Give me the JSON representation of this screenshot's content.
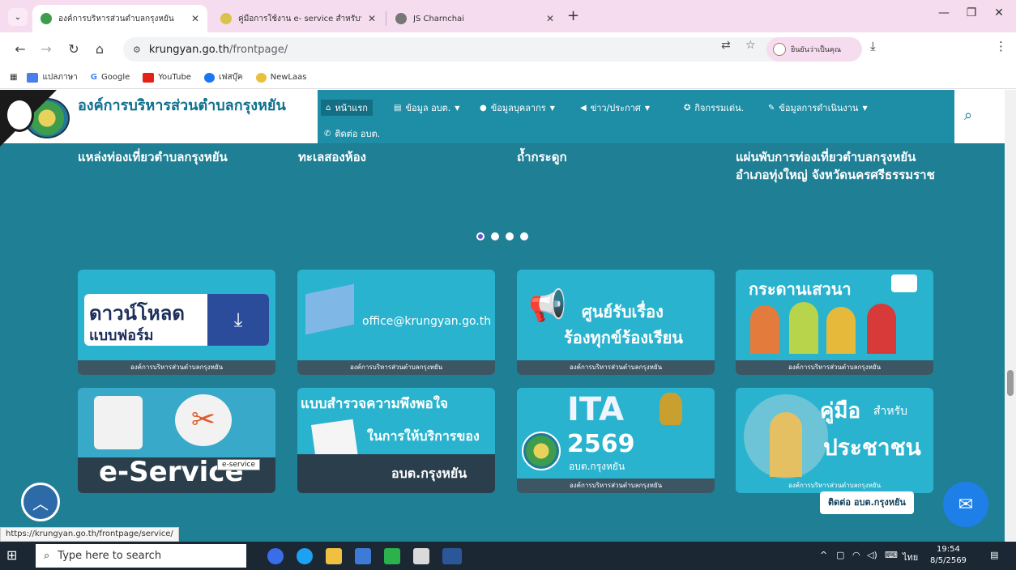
{
  "browser": {
    "tabs": [
      {
        "title": "องค์การบริหารส่วนตำบลกรุงหยัน",
        "active": true
      },
      {
        "title": "คู่มือการใช้งาน e- service สำหรับประ",
        "active": false
      },
      {
        "title": "JS Charnchai",
        "active": false
      }
    ],
    "new_tab": "+",
    "url_host": "krungyan.go.th",
    "url_path": "/frontpage/",
    "profile_label": "ยินยันว่าเป็นคุณ",
    "bookmarks": [
      "แปลภาษา",
      "Google",
      "YouTube",
      "เฟสบุ๊ค",
      "NewLaas"
    ],
    "status_url": "https://krungyan.go.th/frontpage/service/"
  },
  "site": {
    "title": "องค์การบริหารส่วนตำบลกรุงหยัน",
    "menu": [
      "หน้าแรก",
      "ข้อมูล อบต.",
      "ข้อมูลบุคลากร",
      "ข่าว/ประกาศ",
      "กิจกรรมเด่น.",
      "ข้อมูลการดำเนินงาน",
      "ติดต่อ อบต."
    ],
    "slider_captions": [
      "แหล่งท่องเที่ยวตำบลกรุงหยัน",
      "ทะเลสองห้อง",
      "ถ้ำกระดูก",
      "แผ่นพับการท่องเที่ยวตำบลกรุงหยัน อำเภอทุ่งใหญ่ จังหวัดนครศรีธรรมราช"
    ],
    "cards": [
      {
        "big": "ดาวน์โหลด",
        "big2": "แบบฟอร์ม",
        "foot": "องค์การบริหารส่วนตำบลกรุงหยัน"
      },
      {
        "big": "office@krungyan.go.th",
        "big2": "",
        "foot": "องค์การบริหารส่วนตำบลกรุงหยัน"
      },
      {
        "big": "ศูนย์รับเรื่อง",
        "big2": "ร้องทุกข์ร้องเรียน",
        "foot": "องค์การบริหารส่วนตำบลกรุงหยัน"
      },
      {
        "big": "กระดานเสวนา",
        "big2": "",
        "foot": "องค์การบริหารส่วนตำบลกรุงหยัน"
      },
      {
        "big": "e-Service",
        "big2": "",
        "foot": ""
      },
      {
        "big": "แบบสำรวจความพึงพอใจ",
        "big2": "ในการให้บริการของ",
        "big3": "อบต.กรุงหยัน",
        "foot": ""
      },
      {
        "big": "ITA",
        "big2": "2569",
        "big3": "อบต.กรุงหยัน",
        "foot": "องค์การบริหารส่วนตำบลกรุงหยัน"
      },
      {
        "big": "คู่มือ",
        "small": "สำหรับ",
        "big2": "ประชาชน",
        "foot": "องค์การบริหารส่วนตำบลกรุงหยัน"
      }
    ],
    "tooltip": "e-service",
    "contact_float": "ติดต่อ อบต.กรุงหยัน"
  },
  "taskbar": {
    "search_placeholder": "Type here to search",
    "lang": "ไทย",
    "time": "19:54",
    "date": "8/5/2569"
  }
}
